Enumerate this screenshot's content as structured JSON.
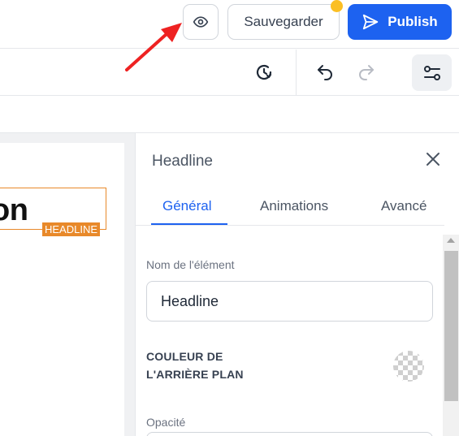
{
  "header": {
    "preview_icon": "eye-icon",
    "save_label": "Sauvegarder",
    "publish_label": "Publish",
    "publish_icon": "send-icon",
    "colors": {
      "publish": "#1d62f0",
      "notification_dot": "#fbbf24"
    }
  },
  "toolbar": {
    "history_icon": "history-icon",
    "undo_icon": "undo-icon",
    "redo_icon": "redo-icon",
    "settings_icon": "sliders-icon"
  },
  "canvas": {
    "headline_text": "on",
    "element_tag": "HEADLINE",
    "highlight_color": "#e8892a"
  },
  "panel": {
    "title": "Headline",
    "close_icon": "close-icon",
    "tabs": [
      {
        "label": "Général",
        "active": true
      },
      {
        "label": "Animations",
        "active": false
      },
      {
        "label": "Avancé",
        "active": false
      }
    ],
    "name_label": "Nom de l'élément",
    "name_value": "Headline",
    "bg_color_label_line1": "COULEUR DE",
    "bg_color_label_line2": "L'ARRIÈRE PLAN",
    "bg_color_swatch": "transparent",
    "opacity_label": "Opacité"
  },
  "annotation": {
    "arrow_color": "#ee2222"
  }
}
